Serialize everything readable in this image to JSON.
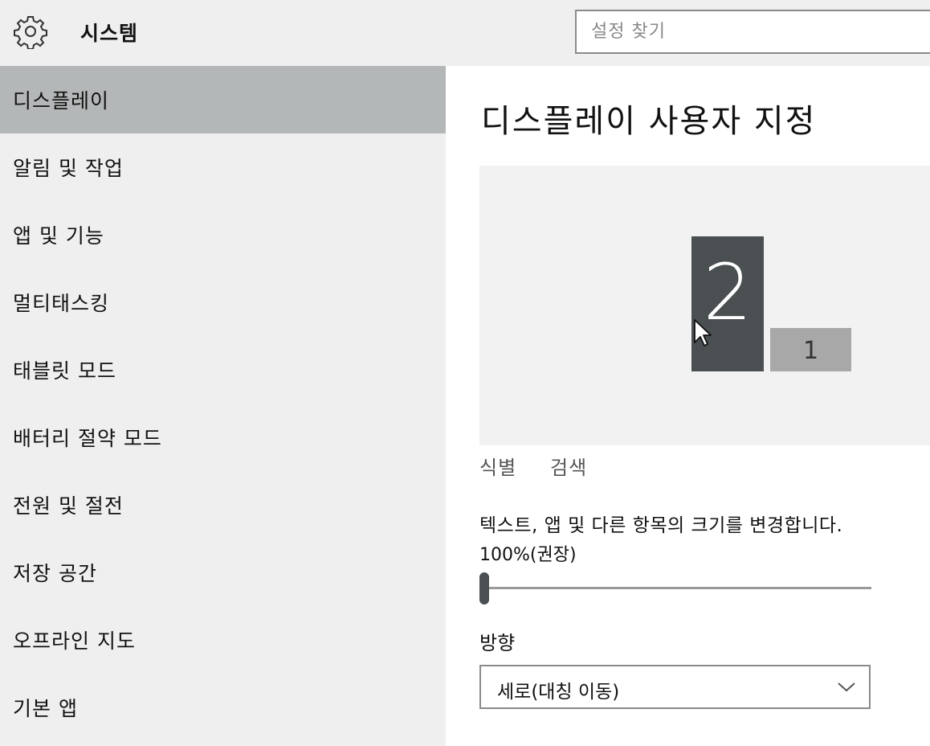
{
  "header": {
    "icon": "gear-icon",
    "title": "시스템",
    "search_placeholder": "설정 찾기"
  },
  "sidebar": {
    "items": [
      {
        "label": "디스플레이",
        "active": true
      },
      {
        "label": "알림 및 작업",
        "active": false
      },
      {
        "label": "앱 및 기능",
        "active": false
      },
      {
        "label": "멀티태스킹",
        "active": false
      },
      {
        "label": "태블릿 모드",
        "active": false
      },
      {
        "label": "배터리 절약 모드",
        "active": false
      },
      {
        "label": "전원 및 절전",
        "active": false
      },
      {
        "label": "저장 공간",
        "active": false
      },
      {
        "label": "오프라인 지도",
        "active": false
      },
      {
        "label": "기본 앱",
        "active": false
      }
    ]
  },
  "main": {
    "title": "디스플레이 사용자 지정",
    "preview": {
      "monitors": [
        {
          "label": "2",
          "selected": true,
          "color": "#4a4f52"
        },
        {
          "label": "1",
          "selected": false,
          "color": "#a8a8a8"
        }
      ]
    },
    "identify_label": "식별",
    "detect_label": "검색",
    "scale": {
      "label": "텍스트, 앱 및 다른 항목의 크기를 변경합니다.",
      "value_text": "100%(권장)",
      "slider_position": 0
    },
    "orientation": {
      "label": "방향",
      "selected": "세로(대칭 이동)"
    }
  },
  "colors": {
    "sidebar_bg": "#efefef",
    "active_item_bg": "#b4b7b7",
    "primary_monitor": "#4a4f52",
    "secondary_monitor": "#a8a8a8"
  }
}
